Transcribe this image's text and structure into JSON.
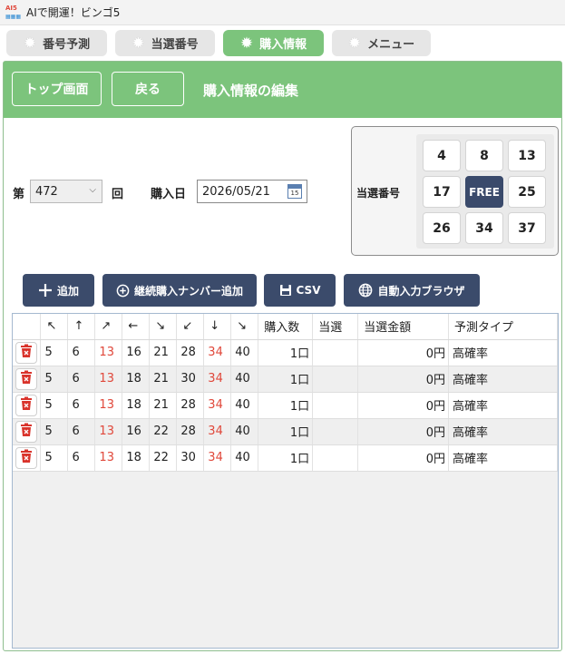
{
  "window": {
    "title": "AIで開運！ビンゴ5",
    "logo_text": "AI5"
  },
  "tabs": [
    {
      "label": "番号予測",
      "active": false
    },
    {
      "label": "当選番号",
      "active": false
    },
    {
      "label": "購入情報",
      "active": true
    },
    {
      "label": "メニュー",
      "active": false
    }
  ],
  "header": {
    "top_button": "トップ画面",
    "back_button": "戻る",
    "page_title": "購入情報の編集"
  },
  "form": {
    "round_prefix": "第",
    "round_value": "472",
    "round_suffix": "回",
    "date_label": "購入日",
    "date_value": "2026/05/21",
    "calendar_day": "15"
  },
  "winning": {
    "label": "当選番号",
    "numbers": [
      "4",
      "8",
      "13",
      "17",
      "FREE",
      "25",
      "26",
      "34",
      "37"
    ]
  },
  "toolbar": {
    "add": "追加",
    "continue_add": "継続購入ナンバー追加",
    "csv": "CSV",
    "auto_browser": "自動入力ブラウザ"
  },
  "table": {
    "headers": [
      "",
      "↖",
      "↑",
      "↗",
      "←",
      "↘",
      "↙",
      "↓",
      "↘",
      "購入数",
      "当選",
      "当選金額",
      "予測タイプ"
    ],
    "rows": [
      {
        "nums": [
          "5",
          "6",
          "13",
          "16",
          "21",
          "28",
          "34",
          "40"
        ],
        "qty": "1口",
        "win": "",
        "amount": "0円",
        "type": "高確率"
      },
      {
        "nums": [
          "5",
          "6",
          "13",
          "18",
          "21",
          "30",
          "34",
          "40"
        ],
        "qty": "1口",
        "win": "",
        "amount": "0円",
        "type": "高確率"
      },
      {
        "nums": [
          "5",
          "6",
          "13",
          "18",
          "21",
          "28",
          "34",
          "40"
        ],
        "qty": "1口",
        "win": "",
        "amount": "0円",
        "type": "高確率"
      },
      {
        "nums": [
          "5",
          "6",
          "13",
          "16",
          "22",
          "28",
          "34",
          "40"
        ],
        "qty": "1口",
        "win": "",
        "amount": "0円",
        "type": "高確率"
      },
      {
        "nums": [
          "5",
          "6",
          "13",
          "18",
          "22",
          "30",
          "34",
          "40"
        ],
        "qty": "1口",
        "win": "",
        "amount": "0円",
        "type": "高確率"
      }
    ]
  },
  "colors": {
    "accent_green": "#7cc47c",
    "navy_button": "#3b4b6b",
    "highlight_number": "#e0483b",
    "delete_icon": "#d9332b"
  }
}
